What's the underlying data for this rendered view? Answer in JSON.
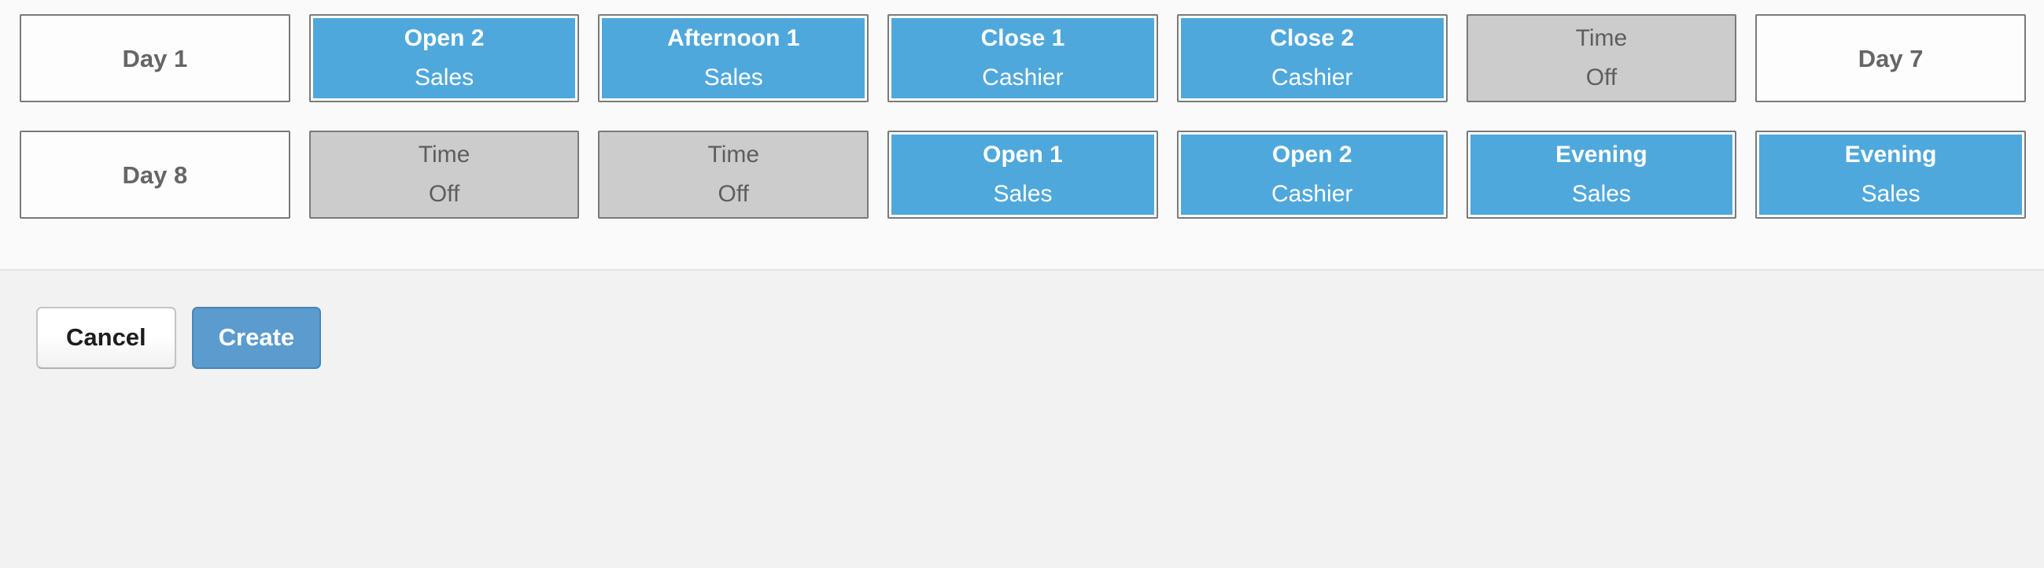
{
  "schedule": {
    "rows": [
      {
        "cells": [
          {
            "kind": "empty",
            "title": "Day 1",
            "sub": ""
          },
          {
            "kind": "assigned",
            "title": "Open 2",
            "sub": "Sales"
          },
          {
            "kind": "assigned",
            "title": "Afternoon 1",
            "sub": "Sales"
          },
          {
            "kind": "assigned",
            "title": "Close 1",
            "sub": "Cashier"
          },
          {
            "kind": "assigned",
            "title": "Close 2",
            "sub": "Cashier"
          },
          {
            "kind": "off",
            "title": "Time",
            "sub": "Off"
          },
          {
            "kind": "empty",
            "title": "Day 7",
            "sub": ""
          }
        ]
      },
      {
        "cells": [
          {
            "kind": "empty",
            "title": "Day 8",
            "sub": ""
          },
          {
            "kind": "off",
            "title": "Time",
            "sub": "Off"
          },
          {
            "kind": "off",
            "title": "Time",
            "sub": "Off"
          },
          {
            "kind": "assigned",
            "title": "Open 1",
            "sub": "Sales"
          },
          {
            "kind": "assigned",
            "title": "Open 2",
            "sub": "Cashier"
          },
          {
            "kind": "assigned",
            "title": "Evening",
            "sub": "Sales"
          },
          {
            "kind": "assigned",
            "title": "Evening",
            "sub": "Sales"
          }
        ]
      }
    ]
  },
  "footer": {
    "cancel_label": "Cancel",
    "create_label": "Create"
  },
  "colors": {
    "assigned_shift": "#4fa8dc",
    "time_off": "#cccccc",
    "card_border": "#7a7a7a",
    "primary_button": "#5b9bce",
    "page_background": "#fafafa",
    "footer_background": "#f2f2f2",
    "divider": "#e4e4e4"
  }
}
